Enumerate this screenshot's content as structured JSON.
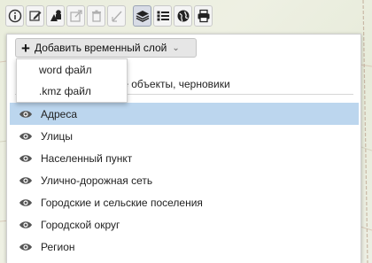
{
  "toolbar": {
    "buttons": [
      {
        "name": "info-icon",
        "active": false,
        "disabled": false
      },
      {
        "name": "edit-icon",
        "active": false,
        "disabled": false
      },
      {
        "name": "shapes-icon",
        "active": false,
        "disabled": false
      },
      {
        "name": "external-link-icon",
        "active": false,
        "disabled": true
      },
      {
        "name": "trash-icon",
        "active": false,
        "disabled": true
      },
      {
        "name": "measure-icon",
        "active": false,
        "disabled": true
      },
      {
        "name": "layers-icon",
        "active": true,
        "disabled": false
      },
      {
        "name": "list-icon",
        "active": false,
        "disabled": false
      },
      {
        "name": "globe-icon",
        "active": false,
        "disabled": false
      },
      {
        "name": "print-icon",
        "active": false,
        "disabled": false
      }
    ]
  },
  "panel": {
    "add_layer_label": "Добавить временный слой",
    "dropdown_options": [
      "word файл",
      ".kmz файл"
    ],
    "drafts_label_visible": "ные объекты, черновики",
    "layers": [
      {
        "label": "Адреса",
        "selected": true
      },
      {
        "label": "Улицы",
        "selected": false
      },
      {
        "label": "Населенный пункт",
        "selected": false
      },
      {
        "label": "Улично-дорожная сеть",
        "selected": false
      },
      {
        "label": "Городские и сельские поселения",
        "selected": false
      },
      {
        "label": "Городской округ",
        "selected": false
      },
      {
        "label": "Регион",
        "selected": false
      }
    ]
  },
  "colors": {
    "selected_row": "#bcd6ee",
    "icon_dark": "#333333",
    "eye_icon": "#555555"
  }
}
